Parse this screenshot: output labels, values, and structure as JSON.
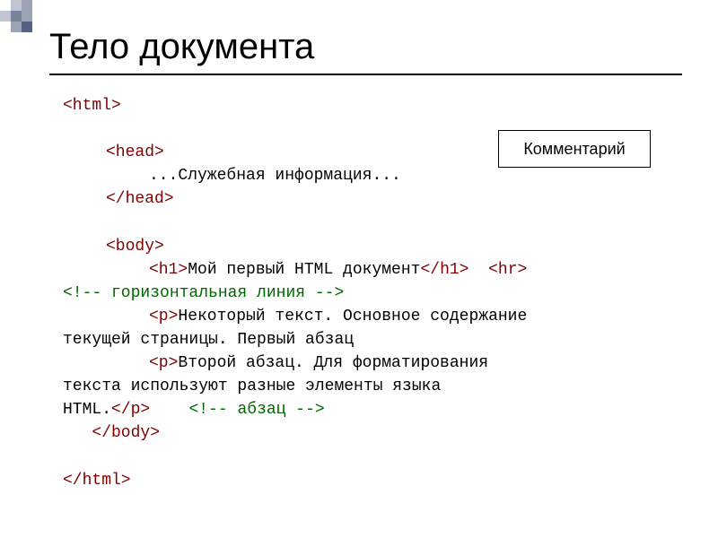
{
  "title": "Тело документа",
  "callout": "Комментарий",
  "code": {
    "l1": "<html>",
    "l2_open": "<head>",
    "l3_text": "...Служебная информация...",
    "l4_close": "</head>",
    "l5_open": "<body>",
    "l6_h1o": "<h1>",
    "l6_txt": "Мой первый HTML документ",
    "l6_h1c": "</h1>",
    "l6_hr": "<hr>",
    "l7_cmt": "<!-- горизонтальная линия -->",
    "l8_po": "<p>",
    "l8_txt": "Некоторый текст. Основное содержание",
    "l9_txt": "текущей страницы. Первый абзац",
    "l10_po": "<p>",
    "l10_txt": "Второй абзац. Для форматирования",
    "l11_txt": "текста используют разные элементы языка",
    "l12_txt": "HTML.",
    "l12_pc": "</p>",
    "l12_cmt": "<!-- абзац -->",
    "l13_close": "</body>",
    "l14": "</html>"
  }
}
